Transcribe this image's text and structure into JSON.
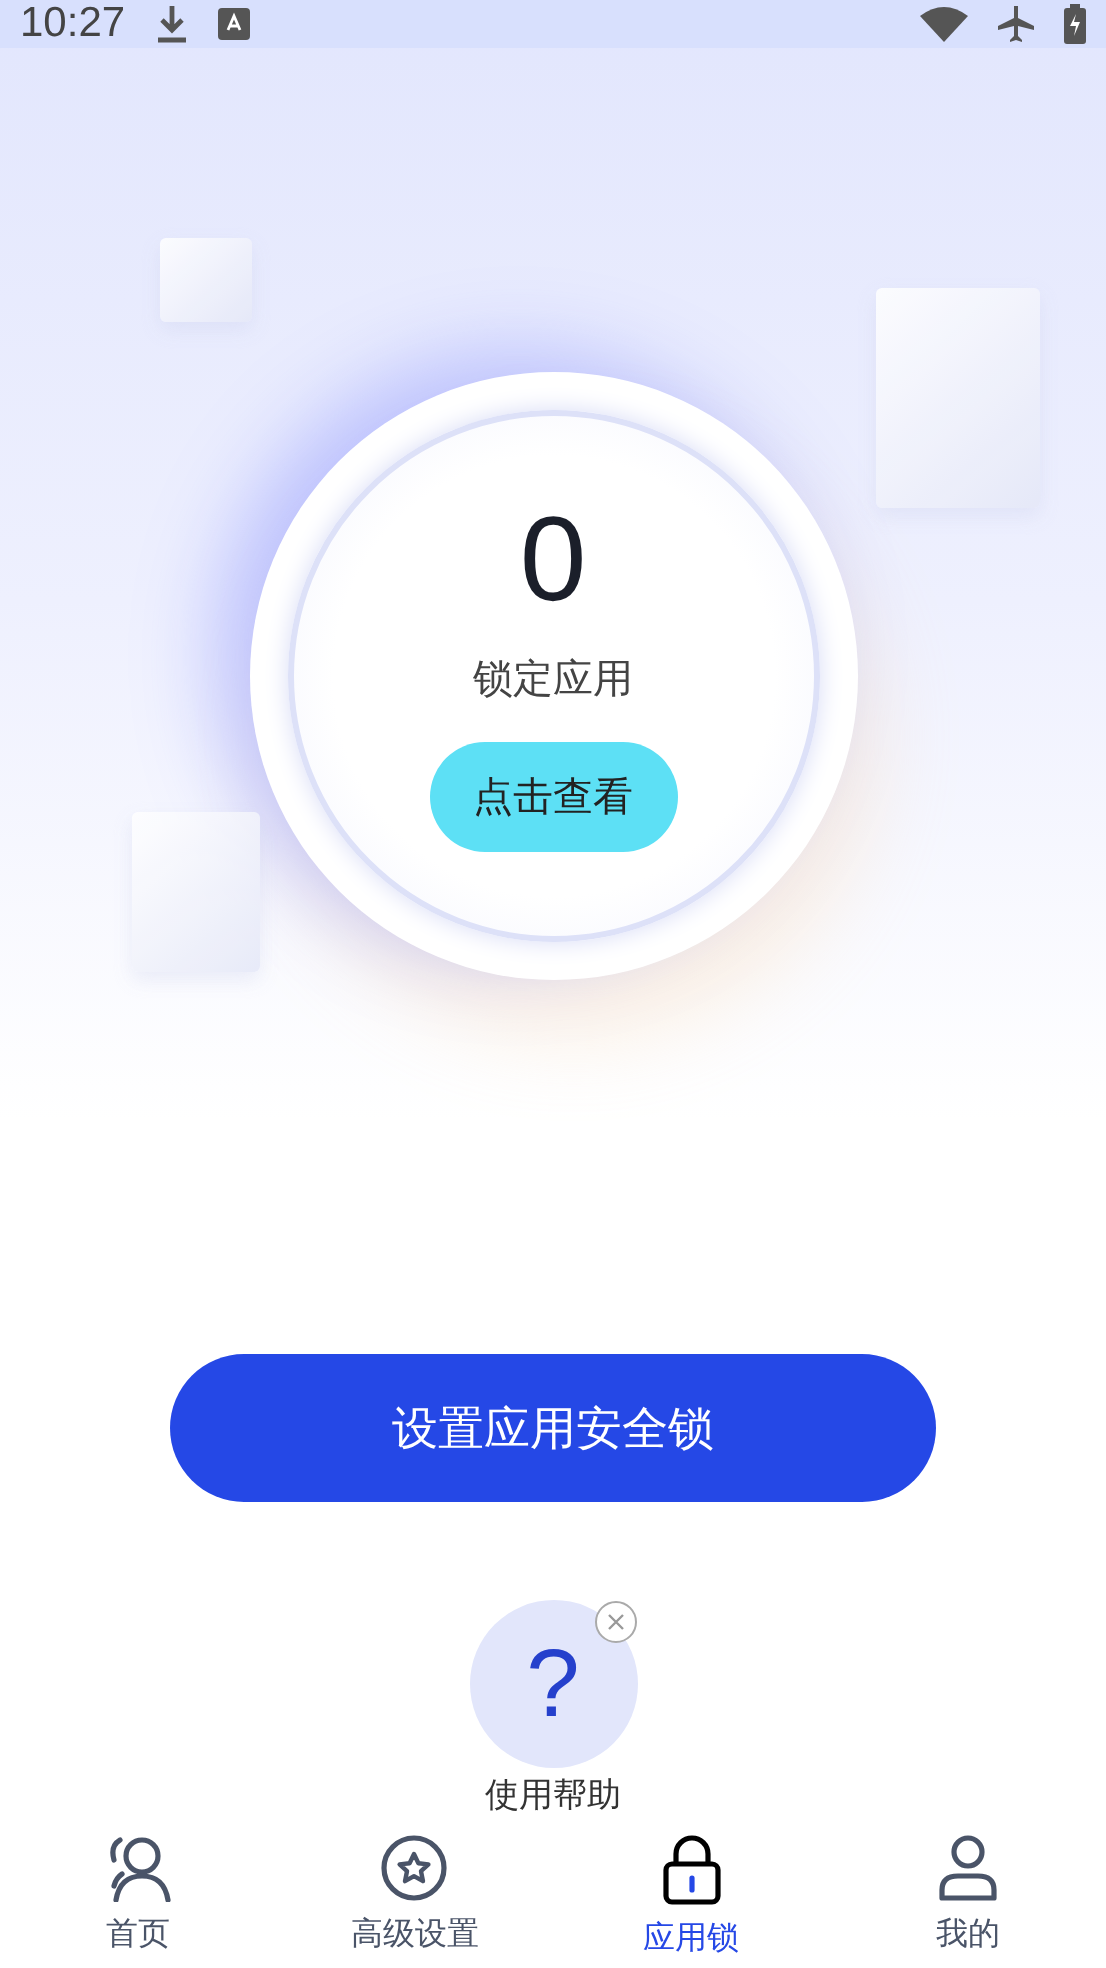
{
  "status_bar": {
    "time": "10:27"
  },
  "lock_summary": {
    "count": "0",
    "label": "锁定应用",
    "view_button": "点击查看"
  },
  "setup_button": "设置应用安全锁",
  "help": {
    "icon_text": "?",
    "label": "使用帮助"
  },
  "tabs": [
    {
      "label": "首页",
      "kind": "people",
      "selected": false
    },
    {
      "label": "高级设置",
      "kind": "star",
      "selected": false
    },
    {
      "label": "应用锁",
      "kind": "lock",
      "selected": true
    },
    {
      "label": "我的",
      "kind": "person",
      "selected": false
    }
  ]
}
